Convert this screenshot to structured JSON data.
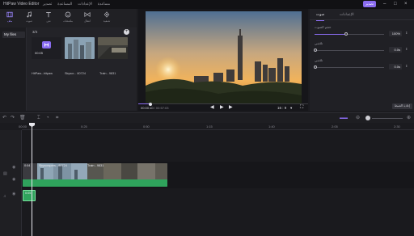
{
  "app": {
    "title": "HitPaw Video Editor"
  },
  "menu": [
    "تصدير",
    "المساعدة",
    "الإعدادات",
    "مساعدة"
  ],
  "header": {
    "export_label": "تصدير"
  },
  "toolbar": {
    "tools": [
      {
        "label": "ملف",
        "icon": "film-icon"
      },
      {
        "label": "صوت",
        "icon": "music-icon"
      },
      {
        "label": "نص",
        "icon": "text-icon"
      },
      {
        "label": "ملصقات",
        "icon": "sticker-icon"
      },
      {
        "label": "انتقال",
        "icon": "transition-icon"
      },
      {
        "label": "تصفية",
        "icon": "filter-icon"
      }
    ]
  },
  "media": {
    "sidebar_label": "My files",
    "count_label": "3/4",
    "items": [
      {
        "name": "HitPaw...hitpaw",
        "duration": "00:05"
      },
      {
        "name": "Skyscr... 80724",
        "duration": ""
      },
      {
        "name": "Train - 9831",
        "duration": ""
      }
    ]
  },
  "preview": {
    "current_time": "00:00:10",
    "total_time": "/ 00:57:03",
    "aspect_ratio": "16 : 9",
    "progress": 0.07
  },
  "properties": {
    "tabs": [
      "صوت",
      "الإعدادات"
    ],
    "volume": {
      "label": "حجم الصوت",
      "value": "100%",
      "level": 0.45
    },
    "fade_in": {
      "label": "تلاشي",
      "value": "0.0s"
    },
    "fade_out": {
      "label": "تلاشي",
      "value": "0.0s"
    },
    "reset_label": "إعادة الضبط"
  },
  "timeline": {
    "ruler": [
      "00:00",
      "0:25",
      "0:50",
      "1:15",
      "1:40",
      "2:05",
      "2:30"
    ],
    "video_clips": [
      {
        "label": "0:04"
      },
      {
        "label": "Skyscrapers - 80724"
      },
      {
        "label": "Train - 9831"
      }
    ],
    "audio_clip": {
      "label": "0:05"
    }
  },
  "colors": {
    "accent": "#8a6cf0",
    "audio": "#2fa35c",
    "video_clip": "#3aa69a"
  }
}
